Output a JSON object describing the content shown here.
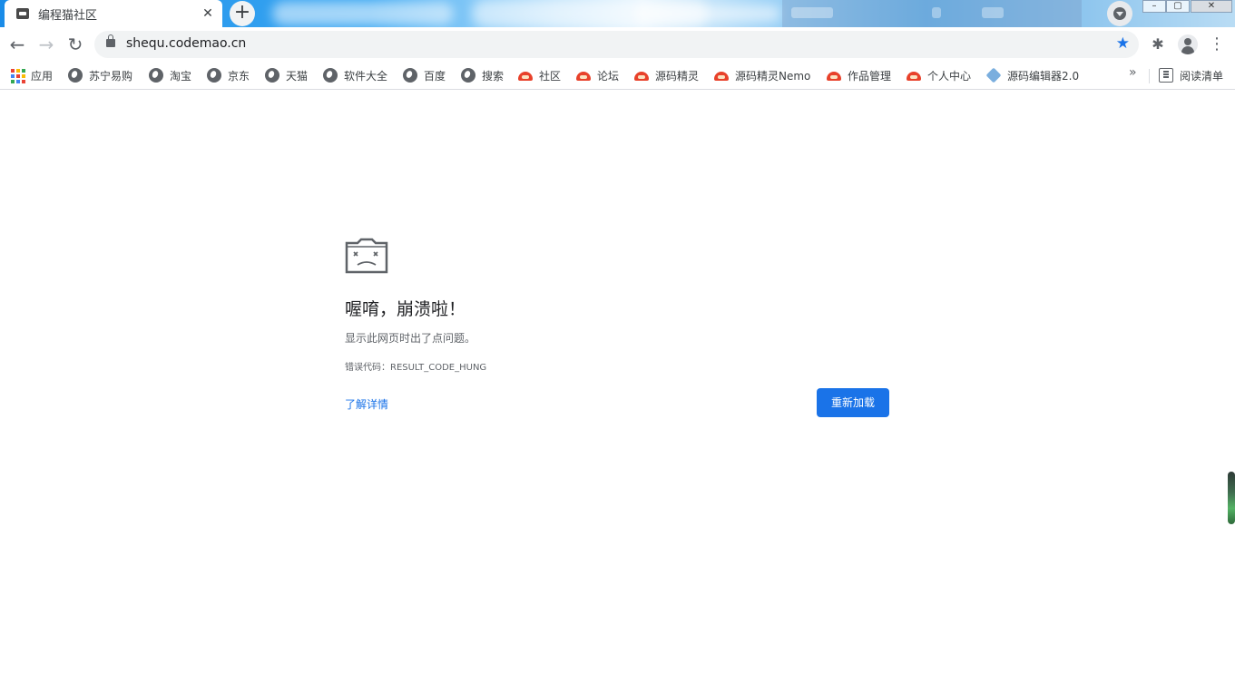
{
  "window": {
    "tab_title": "编程猫社区",
    "tab_close": "✕",
    "new_tab": "+",
    "controls": {
      "minimize": "–",
      "maximize": "▢",
      "close": "✕"
    }
  },
  "toolbar": {
    "back": "←",
    "forward": "→",
    "reload": "↻",
    "url": "shequ.codemao.cn",
    "bookmark_star": "★",
    "extensions": "✱",
    "menu": "⋮"
  },
  "bookmarks": {
    "items": [
      {
        "label": "应用",
        "icon": "apps-grid-icon"
      },
      {
        "label": "苏宁易购",
        "icon": "globe-icon"
      },
      {
        "label": "淘宝",
        "icon": "globe-icon"
      },
      {
        "label": "京东",
        "icon": "globe-icon"
      },
      {
        "label": "天猫",
        "icon": "globe-icon"
      },
      {
        "label": "软件大全",
        "icon": "globe-icon"
      },
      {
        "label": "百度",
        "icon": "globe-icon"
      },
      {
        "label": "搜索",
        "icon": "globe-icon"
      },
      {
        "label": "社区",
        "icon": "codemao-icon"
      },
      {
        "label": "论坛",
        "icon": "codemao-icon"
      },
      {
        "label": "源码精灵",
        "icon": "codemao-icon"
      },
      {
        "label": "源码精灵Nemo",
        "icon": "codemao-icon"
      },
      {
        "label": "作品管理",
        "icon": "codemao-icon"
      },
      {
        "label": "个人中心",
        "icon": "codemao-icon"
      },
      {
        "label": "源码编辑器2.0",
        "icon": "nemo-icon"
      }
    ],
    "overflow": "»",
    "reading_list": "阅读清单"
  },
  "crash": {
    "title": "喔唷，崩溃啦！",
    "message": "显示此网页时出了点问题。",
    "error_code": "错误代码：RESULT_CODE_HUNG",
    "learn_more": "了解详情",
    "reload_button": "重新加载"
  },
  "colors": {
    "accent": "#1a73e8",
    "tab_strip": "#3aa7f2",
    "codemao_brand": "#e8412a"
  }
}
